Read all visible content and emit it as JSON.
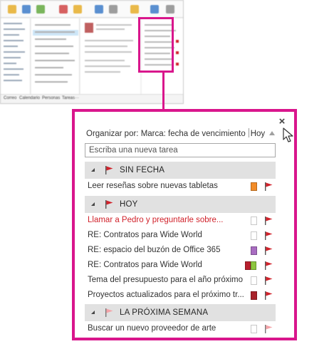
{
  "thumbnail": {
    "nav_items": [
      "Correo",
      "Calendario",
      "Personas",
      "Tareas",
      "···"
    ]
  },
  "panel": {
    "close_label": "×",
    "arrange_label": "Organizar por: Marca: fecha de vencimiento",
    "arrange_value": "Hoy",
    "new_task_placeholder": "Escriba una nueva tarea",
    "colors": {
      "highlight": "#d9168c",
      "flag_red": "#d1222b",
      "flag_light": "#f4a3a8",
      "overdue_text": "#d1222b"
    },
    "groups": [
      {
        "title": "SIN FECHA",
        "flag": "red-flag-icon",
        "tasks": [
          {
            "title": "Leer reseñas sobre nuevas tabletas",
            "categories": [
              "#f28c28"
            ],
            "overdue": false,
            "flag": "red"
          }
        ]
      },
      {
        "title": "HOY",
        "flag": "red-flag-icon",
        "tasks": [
          {
            "title": "Llamar a Pedro y preguntarle sobre...",
            "categories": [],
            "overdue": true,
            "flag": "red"
          },
          {
            "title": "RE: Contratos para Wide World",
            "categories": [],
            "overdue": false,
            "flag": "red"
          },
          {
            "title": "RE: espacio del buzón de Office 365",
            "categories": [
              "#a86cc1"
            ],
            "overdue": false,
            "flag": "red"
          },
          {
            "title": "RE: Contratos para Wide World",
            "categories": [
              "#b8202e",
              "#8dc63f"
            ],
            "overdue": false,
            "flag": "red"
          },
          {
            "title": "Tema del presupuesto para el año próximo",
            "categories": [],
            "overdue": false,
            "flag": "red"
          },
          {
            "title": "Proyectos actualizados para el próximo tr...",
            "categories": [
              "#a8232b"
            ],
            "overdue": false,
            "flag": "red"
          }
        ]
      },
      {
        "title": "LA PRÓXIMA SEMANA",
        "flag": "light-flag-icon",
        "tasks": [
          {
            "title": "Buscar un nuevo proveedor de arte",
            "categories": [],
            "overdue": false,
            "flag": "light"
          }
        ]
      }
    ]
  }
}
